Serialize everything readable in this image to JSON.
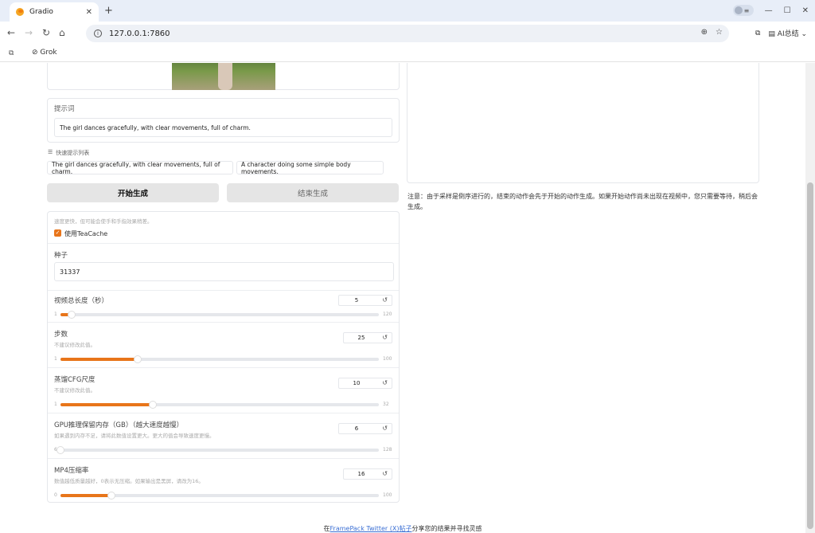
{
  "browser": {
    "tab_title": "Gradio",
    "tab_close": "✕",
    "new_tab": "+",
    "url": "127.0.0.1:7860",
    "ai_summary": "AI总结",
    "bookmarks": [
      {
        "label": "Grok"
      }
    ]
  },
  "left": {
    "prompt_label": "提示词",
    "prompt_value": "The girl dances gracefully, with clear movements, full of charm.",
    "quick_list_label": "快速提示列表",
    "quick_prompts": [
      "The girl dances gracefully, with clear movements, full of charm.",
      "A character doing some simple body movements."
    ],
    "start_button": "开始生成",
    "stop_button": "结束生成"
  },
  "settings": {
    "teacache_hint": "速度更快，但可能会使手和手指效果稍差。",
    "teacache_label": "使用TeaCache",
    "teacache_checked": true,
    "seed_label": "种子",
    "seed_value": "31337",
    "sliders": [
      {
        "label": "视频总长度（秒）",
        "hint": "",
        "value": "5",
        "min": "1",
        "max": "120",
        "fraction": 0.034
      },
      {
        "label": "步数",
        "hint": "不建议修改此值。",
        "value": "25",
        "min": "1",
        "max": "100",
        "fraction": 0.242
      },
      {
        "label": "蒸馏CFG尺度",
        "hint": "不建议修改此值。",
        "value": "10",
        "min": "1",
        "max": "32",
        "fraction": 0.29
      },
      {
        "label": "GPU推理保留内存（GB）（越大速度越慢）",
        "hint": "如果遇到内存不足，请将此数值设置更大。更大的值会导致速度更慢。",
        "value": "6",
        "min": "6",
        "max": "128",
        "fraction": 0.0
      },
      {
        "label": "MP4压缩率",
        "hint": "数值越低质量越好，0表示无压缩。如果输出是黑屏，请改为16。",
        "value": "16",
        "min": "0",
        "max": "100",
        "fraction": 0.16
      }
    ]
  },
  "right": {
    "notice": "注意：由于采样是倒序进行的，结束的动作会先于开始的动作生成。如果开始动作尚未出现在视频中，您只需要等待，稍后会生成。"
  },
  "footer": {
    "prefix": "在",
    "link": "FramePack Twitter (X)帖子",
    "suffix": "分享您的结果并寻找灵感"
  },
  "colors": {
    "accent": "#e8751a",
    "link": "#3b6fd4"
  }
}
